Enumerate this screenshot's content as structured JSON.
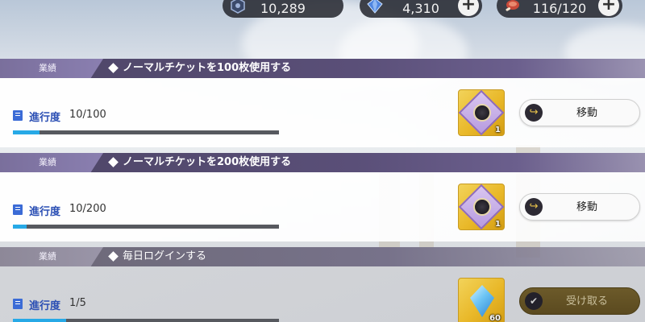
{
  "currencies": [
    {
      "icon": "hexagon-coin-icon",
      "value": "10,289",
      "has_plus": false
    },
    {
      "icon": "blue-gem-icon",
      "value": "4,310",
      "has_plus": true
    },
    {
      "icon": "stamina-meat-icon",
      "value": "116/120",
      "has_plus": true
    }
  ],
  "missions": [
    {
      "tag": "業績",
      "title": "ノーマルチケットを100枚使用する",
      "progress_label": "進行度",
      "progress_value": "10/100",
      "progress_fraction": 0.1,
      "reward_icon": "purple-medal-ticket-icon",
      "reward_count": "1",
      "button_label": "移動",
      "state": "go"
    },
    {
      "tag": "業績",
      "title": "ノーマルチケットを200枚使用する",
      "progress_label": "進行度",
      "progress_value": "10/200",
      "progress_fraction": 0.05,
      "reward_icon": "purple-shield-ticket-icon",
      "reward_count": "1",
      "button_label": "移動",
      "state": "go"
    },
    {
      "tag": "業績",
      "title": "毎日ログインする",
      "progress_label": "進行度",
      "progress_value": "1/5",
      "progress_fraction": 0.2,
      "reward_icon": "blue-crystal-icon",
      "reward_count": "60",
      "button_label": "受け取る",
      "state": "claim"
    }
  ]
}
